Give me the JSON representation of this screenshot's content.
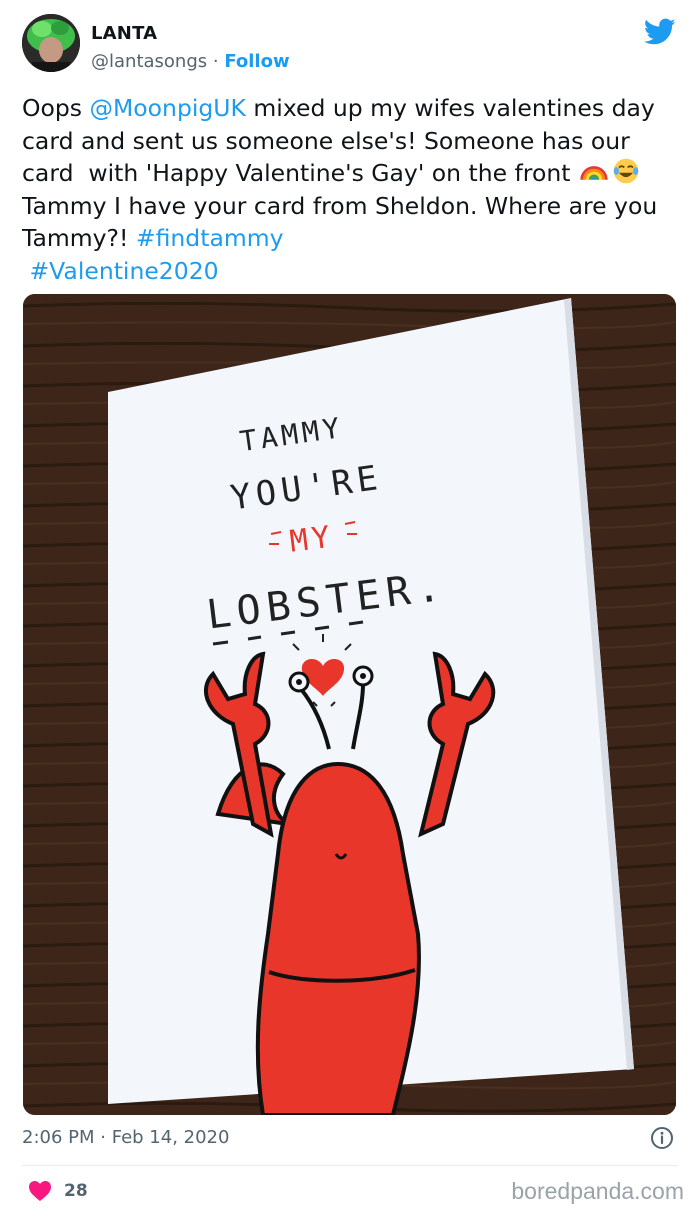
{
  "author": {
    "display_name": "LANTA",
    "handle": "@lantasongs",
    "separator": " · ",
    "follow_label": "Follow"
  },
  "icons": {
    "platform": "twitter-bird-icon",
    "avatar": "green-haired-profile-avatar",
    "like": "heart-icon",
    "info": "info-circle-icon",
    "emoji_1": "rainbow-emoji",
    "emoji_2": "tears-of-joy-emoji"
  },
  "tweet": {
    "t1": "Oops ",
    "mention": "@MoonpigUK",
    "t2": " mixed up my wifes valentines day card and sent us someone else's! Someone has our card  with 'Happy Valentine's Gay' on the front ",
    "t3": " Tammy I have your card from Sheldon. Where are you Tammy?! ",
    "hashtag_1": "#findtammy",
    "hashtag_2": "#Valentine2020"
  },
  "card": {
    "line1": "TAMMY",
    "line2": "YOU'RE",
    "line3": "MY",
    "line4": "LOBSTER."
  },
  "footer": {
    "time": "2:06 PM",
    "separator": " · ",
    "date": "Feb 14, 2020",
    "like_count": "28",
    "watermark": "boredpanda.com"
  },
  "colors": {
    "link": "#1d9bf0",
    "like": "#f91880",
    "lobster": "#e8362b",
    "card": "#f3f6fb",
    "table": "#3a2418"
  }
}
